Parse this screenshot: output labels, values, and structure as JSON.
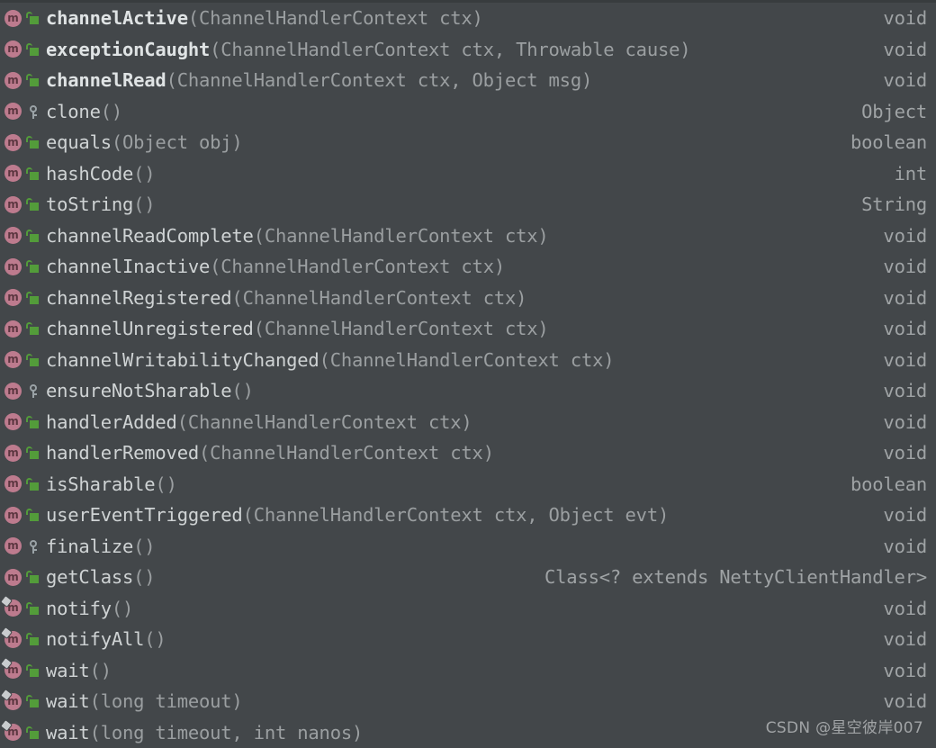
{
  "popup": {
    "kind": "code-completion-method-list",
    "theme": {
      "background": "#43474a",
      "top_border": "#383c3e",
      "method_icon": "#bd7b8e",
      "public_lock_icon": "#539c3a",
      "protected_key_icon": "#9aa2a6",
      "method_name_color": "#cfd3d4",
      "params_color": "#9b9fa1",
      "return_type_color": "#9fa3a5"
    },
    "icon_names": {
      "method": "method-icon",
      "public": "public-padlock-icon",
      "protected": "protected-key-icon",
      "final": "final-marker-icon"
    },
    "rows": [
      {
        "icon": "method-icon",
        "access": "public",
        "final": false,
        "bold": true,
        "name": "channelActive",
        "params": "(ChannelHandlerContext ctx)",
        "return": "void"
      },
      {
        "icon": "method-icon",
        "access": "public",
        "final": false,
        "bold": true,
        "name": "exceptionCaught",
        "params": "(ChannelHandlerContext ctx, Throwable cause)",
        "return": "void"
      },
      {
        "icon": "method-icon",
        "access": "public",
        "final": false,
        "bold": true,
        "name": "channelRead",
        "params": "(ChannelHandlerContext ctx, Object msg)",
        "return": "void"
      },
      {
        "icon": "method-icon",
        "access": "protected",
        "final": false,
        "bold": false,
        "name": "clone",
        "params": "()",
        "return": "Object"
      },
      {
        "icon": "method-icon",
        "access": "public",
        "final": false,
        "bold": false,
        "name": "equals",
        "params": "(Object obj)",
        "return": "boolean"
      },
      {
        "icon": "method-icon",
        "access": "public",
        "final": false,
        "bold": false,
        "name": "hashCode",
        "params": "()",
        "return": "int"
      },
      {
        "icon": "method-icon",
        "access": "public",
        "final": false,
        "bold": false,
        "name": "toString",
        "params": "()",
        "return": "String"
      },
      {
        "icon": "method-icon",
        "access": "public",
        "final": false,
        "bold": false,
        "name": "channelReadComplete",
        "params": "(ChannelHandlerContext ctx)",
        "return": "void"
      },
      {
        "icon": "method-icon",
        "access": "public",
        "final": false,
        "bold": false,
        "name": "channelInactive",
        "params": "(ChannelHandlerContext ctx)",
        "return": "void"
      },
      {
        "icon": "method-icon",
        "access": "public",
        "final": false,
        "bold": false,
        "name": "channelRegistered",
        "params": "(ChannelHandlerContext ctx)",
        "return": "void"
      },
      {
        "icon": "method-icon",
        "access": "public",
        "final": false,
        "bold": false,
        "name": "channelUnregistered",
        "params": "(ChannelHandlerContext ctx)",
        "return": "void"
      },
      {
        "icon": "method-icon",
        "access": "public",
        "final": false,
        "bold": false,
        "name": "channelWritabilityChanged",
        "params": "(ChannelHandlerContext ctx)",
        "return": "void"
      },
      {
        "icon": "method-icon",
        "access": "protected",
        "final": false,
        "bold": false,
        "name": "ensureNotSharable",
        "params": "()",
        "return": "void"
      },
      {
        "icon": "method-icon",
        "access": "public",
        "final": false,
        "bold": false,
        "name": "handlerAdded",
        "params": "(ChannelHandlerContext ctx)",
        "return": "void"
      },
      {
        "icon": "method-icon",
        "access": "public",
        "final": false,
        "bold": false,
        "name": "handlerRemoved",
        "params": "(ChannelHandlerContext ctx)",
        "return": "void"
      },
      {
        "icon": "method-icon",
        "access": "public",
        "final": false,
        "bold": false,
        "name": "isSharable",
        "params": "()",
        "return": "boolean"
      },
      {
        "icon": "method-icon",
        "access": "public",
        "final": false,
        "bold": false,
        "name": "userEventTriggered",
        "params": "(ChannelHandlerContext ctx, Object evt)",
        "return": "void"
      },
      {
        "icon": "method-icon",
        "access": "protected",
        "final": false,
        "bold": false,
        "name": "finalize",
        "params": "()",
        "return": "void"
      },
      {
        "icon": "method-icon",
        "access": "public",
        "final": false,
        "bold": false,
        "name": "getClass",
        "params": "()",
        "return": "Class<? extends NettyClientHandler>"
      },
      {
        "icon": "method-icon",
        "access": "public",
        "final": true,
        "bold": false,
        "name": "notify",
        "params": "()",
        "return": "void"
      },
      {
        "icon": "method-icon",
        "access": "public",
        "final": true,
        "bold": false,
        "name": "notifyAll",
        "params": "()",
        "return": "void"
      },
      {
        "icon": "method-icon",
        "access": "public",
        "final": true,
        "bold": false,
        "name": "wait",
        "params": "()",
        "return": "void"
      },
      {
        "icon": "method-icon",
        "access": "public",
        "final": true,
        "bold": false,
        "name": "wait",
        "params": "(long timeout)",
        "return": "void"
      },
      {
        "icon": "method-icon",
        "access": "public",
        "final": true,
        "bold": false,
        "name": "wait",
        "params": "(long timeout, int nanos)",
        "return": ""
      }
    ]
  },
  "watermark": {
    "text": "CSDN @星空彼岸007"
  }
}
